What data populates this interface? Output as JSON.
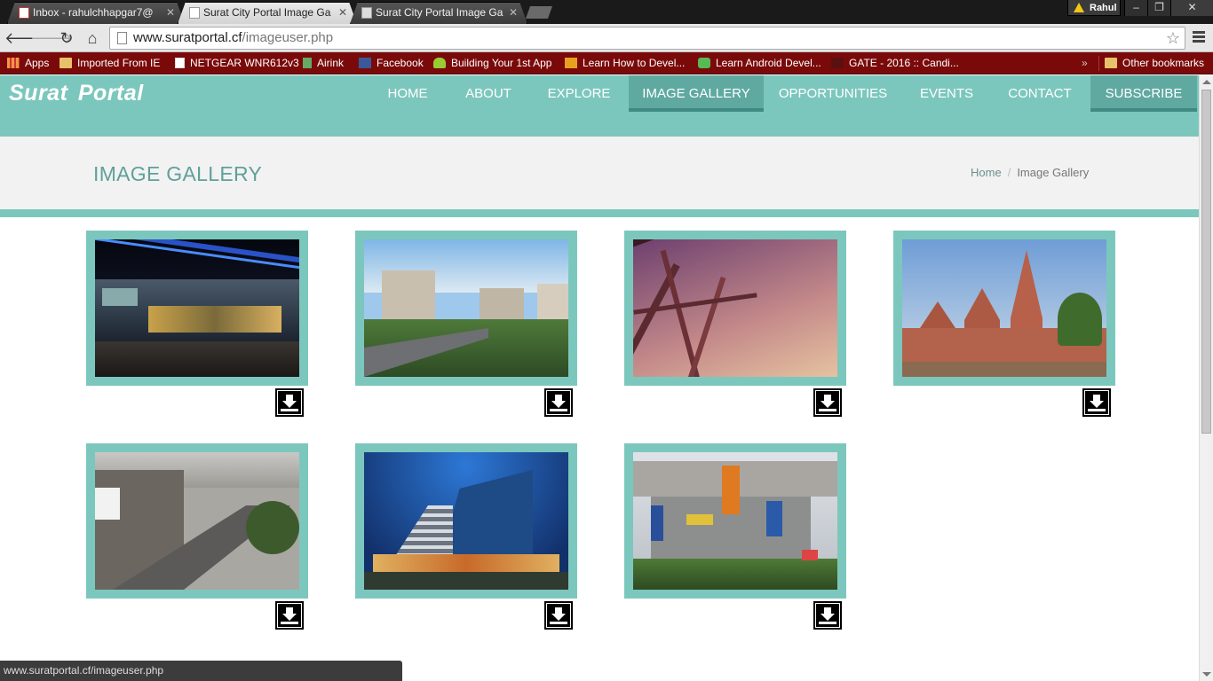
{
  "browser": {
    "tabs": [
      {
        "title": "Inbox - rahulchhapgar7@",
        "active": false
      },
      {
        "title": "Surat City Portal Image Ga",
        "active": true
      },
      {
        "title": "Surat City Portal Image Ga",
        "active": false
      }
    ],
    "user": "Rahul",
    "window_buttons": [
      "–",
      "❐",
      "✕"
    ],
    "address": {
      "host": "www.suratportal.cf",
      "path": "/imageuser.php"
    },
    "bookmarks": [
      {
        "label": "Apps",
        "icon": "apps-icon"
      },
      {
        "label": "Imported From IE",
        "icon": "folder-icon"
      },
      {
        "label": "NETGEAR WNR612v3",
        "icon": "page-icon"
      },
      {
        "label": "Airink",
        "icon": "airink-icon"
      },
      {
        "label": "Facebook",
        "icon": "facebook-icon"
      },
      {
        "label": "Building Your 1st App",
        "icon": "android-icon"
      },
      {
        "label": "Learn How to Devel...",
        "icon": "dollar-icon"
      },
      {
        "label": "Learn Android Devel...",
        "icon": "shield-icon"
      },
      {
        "label": "GATE - 2016 :: Candi...",
        "icon": "gate-icon"
      }
    ],
    "overflow": "»",
    "other_bookmarks": "Other bookmarks",
    "status_url": "www.suratportal.cf/imageuser.php"
  },
  "site": {
    "logo": "Surat  Portal",
    "nav": [
      "HOME",
      "ABOUT",
      "EXPLORE",
      "IMAGE GALLERY",
      "OPPORTUNITIES",
      "EVENTS",
      "CONTACT",
      "SUBSCRIBE"
    ],
    "active_nav": "IMAGE GALLERY",
    "page_title": "IMAGE GALLERY",
    "breadcrumb": {
      "home": "Home",
      "separator": "/",
      "current": "Image Gallery"
    },
    "colors": {
      "teal": "#7cc7bd",
      "teal_dark": "#5fa9a1",
      "title": "#5fa09a"
    },
    "gallery": [
      {
        "subject": "shopping mall at night",
        "icon": "download-icon"
      },
      {
        "subject": "city road with buildings",
        "icon": "download-icon"
      },
      {
        "subject": "bridge structure against sky",
        "icon": "download-icon"
      },
      {
        "subject": "temple",
        "icon": "download-icon"
      },
      {
        "subject": "flyover",
        "icon": "download-icon"
      },
      {
        "subject": "curved glass building",
        "icon": "download-icon"
      },
      {
        "subject": "colourful apartment complex",
        "icon": "download-icon"
      }
    ]
  }
}
